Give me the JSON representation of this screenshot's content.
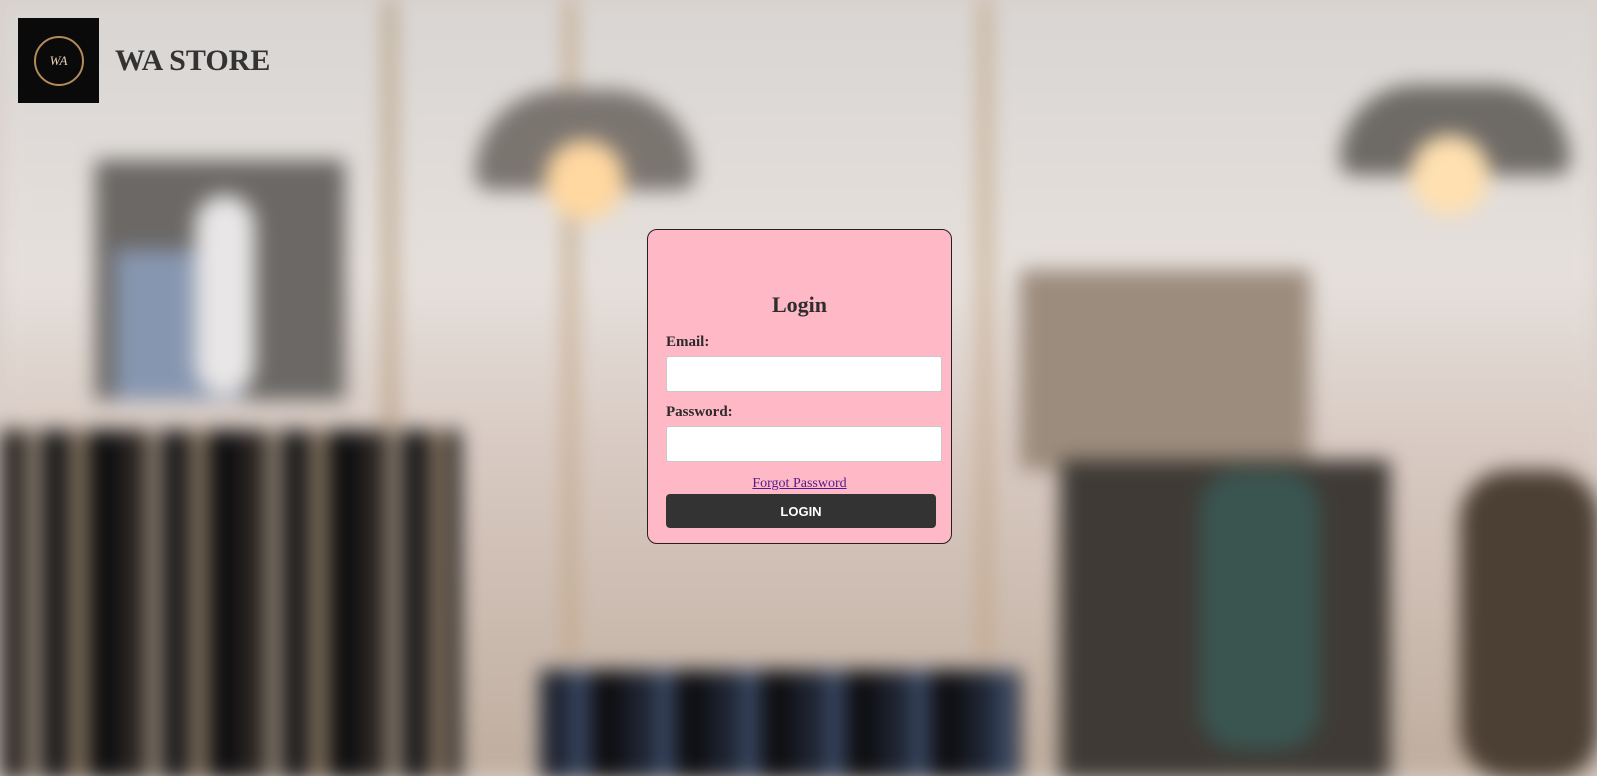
{
  "header": {
    "logo_text": "WA",
    "brand_name": "WA STORE"
  },
  "login_form": {
    "title": "Login",
    "email_label": "Email:",
    "email_value": "",
    "password_label": "Password:",
    "password_value": "",
    "forgot_password_link": "Forgot Password",
    "login_button": "LOGIN"
  },
  "colors": {
    "card_background": "#ffb8c6",
    "button_background": "#333333",
    "link_color": "#551a8b"
  }
}
